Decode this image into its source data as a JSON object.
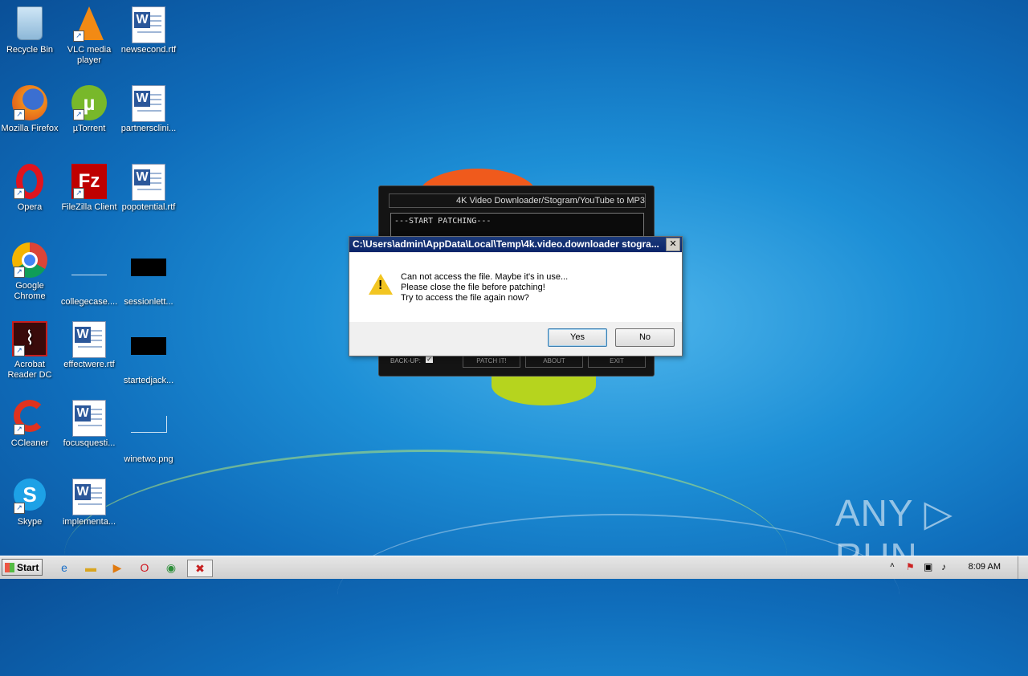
{
  "desktop": {
    "icons": [
      {
        "label": "Recycle Bin"
      },
      {
        "label": "VLC media player"
      },
      {
        "label": "newsecond.rtf"
      },
      {
        "label": "Mozilla Firefox"
      },
      {
        "label": "µTorrent"
      },
      {
        "label": "partnersclini..."
      },
      {
        "label": "Opera"
      },
      {
        "label": "FileZilla Client"
      },
      {
        "label": "popotential.rtf"
      },
      {
        "label": "Google Chrome"
      },
      {
        "label": "collegecase...."
      },
      {
        "label": "sessionlett..."
      },
      {
        "label": "Acrobat Reader DC"
      },
      {
        "label": "effectwere.rtf"
      },
      {
        "label": "startedjack..."
      },
      {
        "label": "CCleaner"
      },
      {
        "label": "focusquesti..."
      },
      {
        "label": "winetwo.png"
      },
      {
        "label": "Skype"
      },
      {
        "label": "implementa..."
      }
    ]
  },
  "patcher": {
    "title": "4K Video Downloader/Stogram/YouTube to MP3",
    "log": "---START PATCHING---",
    "backup_label": "BACK-UP:",
    "patch_label": "PATCH IT!",
    "about_label": "ABOUT",
    "exit_label": "EXIT"
  },
  "dialog": {
    "title": "C:\\Users\\admin\\AppData\\Local\\Temp\\4k.video.downloader stogra...",
    "close": "✕",
    "line1": "Can not access the file. Maybe it's in use...",
    "line2": "Please close the file before patching!",
    "line3": "Try to access the file again now?",
    "yes": "Yes",
    "no": "No"
  },
  "taskbar": {
    "start": "Start",
    "clock": "8:09 AM"
  },
  "watermark": "ANY ▷ RUN"
}
